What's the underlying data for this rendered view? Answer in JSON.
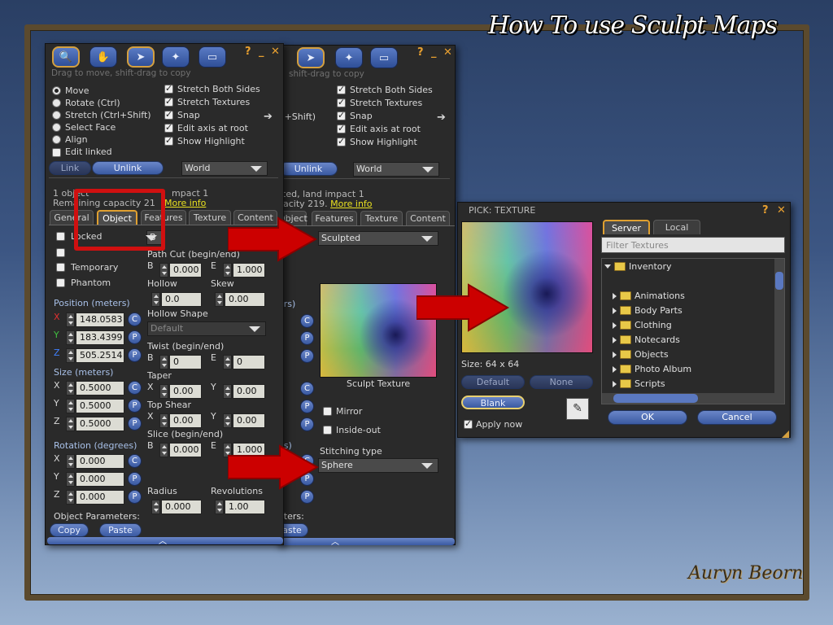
{
  "slide": {
    "title": "How To use Sculpt Maps",
    "signature": "Auryn Beorn"
  },
  "left_panel": {
    "help": "?",
    "minimize": "_",
    "close": "✕",
    "hint": "Drag to move, shift-drag to copy",
    "modes": [
      "Move",
      "Rotate (Ctrl)",
      "Stretch (Ctrl+Shift)",
      "Select Face",
      "Align"
    ],
    "edit_linked": "Edit linked",
    "options": [
      "Stretch Both Sides",
      "Stretch Textures",
      "Snap",
      "Edit axis at root",
      "Show Highlight"
    ],
    "link": "Link",
    "unlink": "Unlink",
    "grid": "World",
    "info1": "1 object",
    "info1b": "mpact 1",
    "info2": "Remaining capacity 21",
    "more_info": "More info",
    "tabs": [
      "General",
      "Object",
      "Features",
      "Texture",
      "Content"
    ],
    "locked": "Locked",
    "temporary": "Temporary",
    "phantom": "Phantom",
    "building_block": "B",
    "position_label": "Position (meters)",
    "pos": {
      "x": "148.0583",
      "y": "183.4399",
      "z": "505.2514"
    },
    "size_label": "Size (meters)",
    "size": {
      "x": "0.5000",
      "y": "0.5000",
      "z": "0.5000"
    },
    "rotation_label": "Rotation (degrees)",
    "rot": {
      "x": "0.000",
      "y": "0.000",
      "z": "0.000"
    },
    "params_label": "Object Parameters:",
    "copy": "Copy",
    "paste": "Paste",
    "path_cut": "Path Cut (begin/end)",
    "b": "B",
    "e": "E",
    "cut_b": "0.000",
    "cut_e": "1.000",
    "hollow": "Hollow",
    "skew": "Skew",
    "hollow_val": "0.0",
    "skew_val": "0.00",
    "hollow_shape": "Hollow Shape",
    "hollow_shape_val": "Default",
    "twist": "Twist (begin/end)",
    "twist_b": "0",
    "twist_e": "0",
    "taper": "Taper",
    "taper_x": "0.00",
    "taper_y": "0.00",
    "top_shear": "Top Shear",
    "shear_x": "0.00",
    "shear_y": "0.00",
    "slice": "Slice (begin/end)",
    "slice_b": "0.000",
    "slice_e": "1.000",
    "radius": "Radius",
    "revolutions": "Revolutions",
    "radius_val": "0.000",
    "rev_val": "1.00",
    "c": "C",
    "p": "P",
    "x": "X",
    "y": "Y",
    "z": "Z"
  },
  "mid_panel": {
    "hint": "shift-drag to copy",
    "options": [
      "Stretch Both Sides",
      "Stretch Textures",
      "Snap",
      "Edit axis at root",
      "Show Highlight"
    ],
    "unlink": "Unlink",
    "grid": "World",
    "info1": "cted, land impact 1",
    "info2": "pacity 219.",
    "more_info": "More info",
    "tabs": [
      "Object",
      "Features",
      "Texture",
      "Content"
    ],
    "partial_text": [
      "l)",
      "rl+Shift)",
      "y",
      "ers)",
      "es)",
      "eters:",
      "aste"
    ],
    "y_axis": "Y",
    "sculpted": "Sculpted",
    "sculpt_texture": "Sculpt Texture",
    "mirror": "Mirror",
    "inside_out": "Inside-out",
    "stitching_type": "Stitching type",
    "stitching_val": "Sphere"
  },
  "picker": {
    "title": "PICK: TEXTURE",
    "help": "?",
    "close": "✕",
    "tabs": [
      "Server",
      "Local"
    ],
    "filter_placeholder": "Filter Textures",
    "size": "Size: 64 x 64",
    "default": "Default",
    "none": "None",
    "blank": "Blank",
    "apply_now": "Apply now",
    "ok": "OK",
    "cancel": "Cancel",
    "inventory": "Inventory",
    "folders": [
      "Animations",
      "Body Parts",
      "Clothing",
      "Notecards",
      "Objects",
      "Photo Album",
      "Scripts"
    ]
  },
  "colors": {
    "accent": "#e0a030",
    "button": "#4a6ab4",
    "arrow": "#cc0000"
  }
}
